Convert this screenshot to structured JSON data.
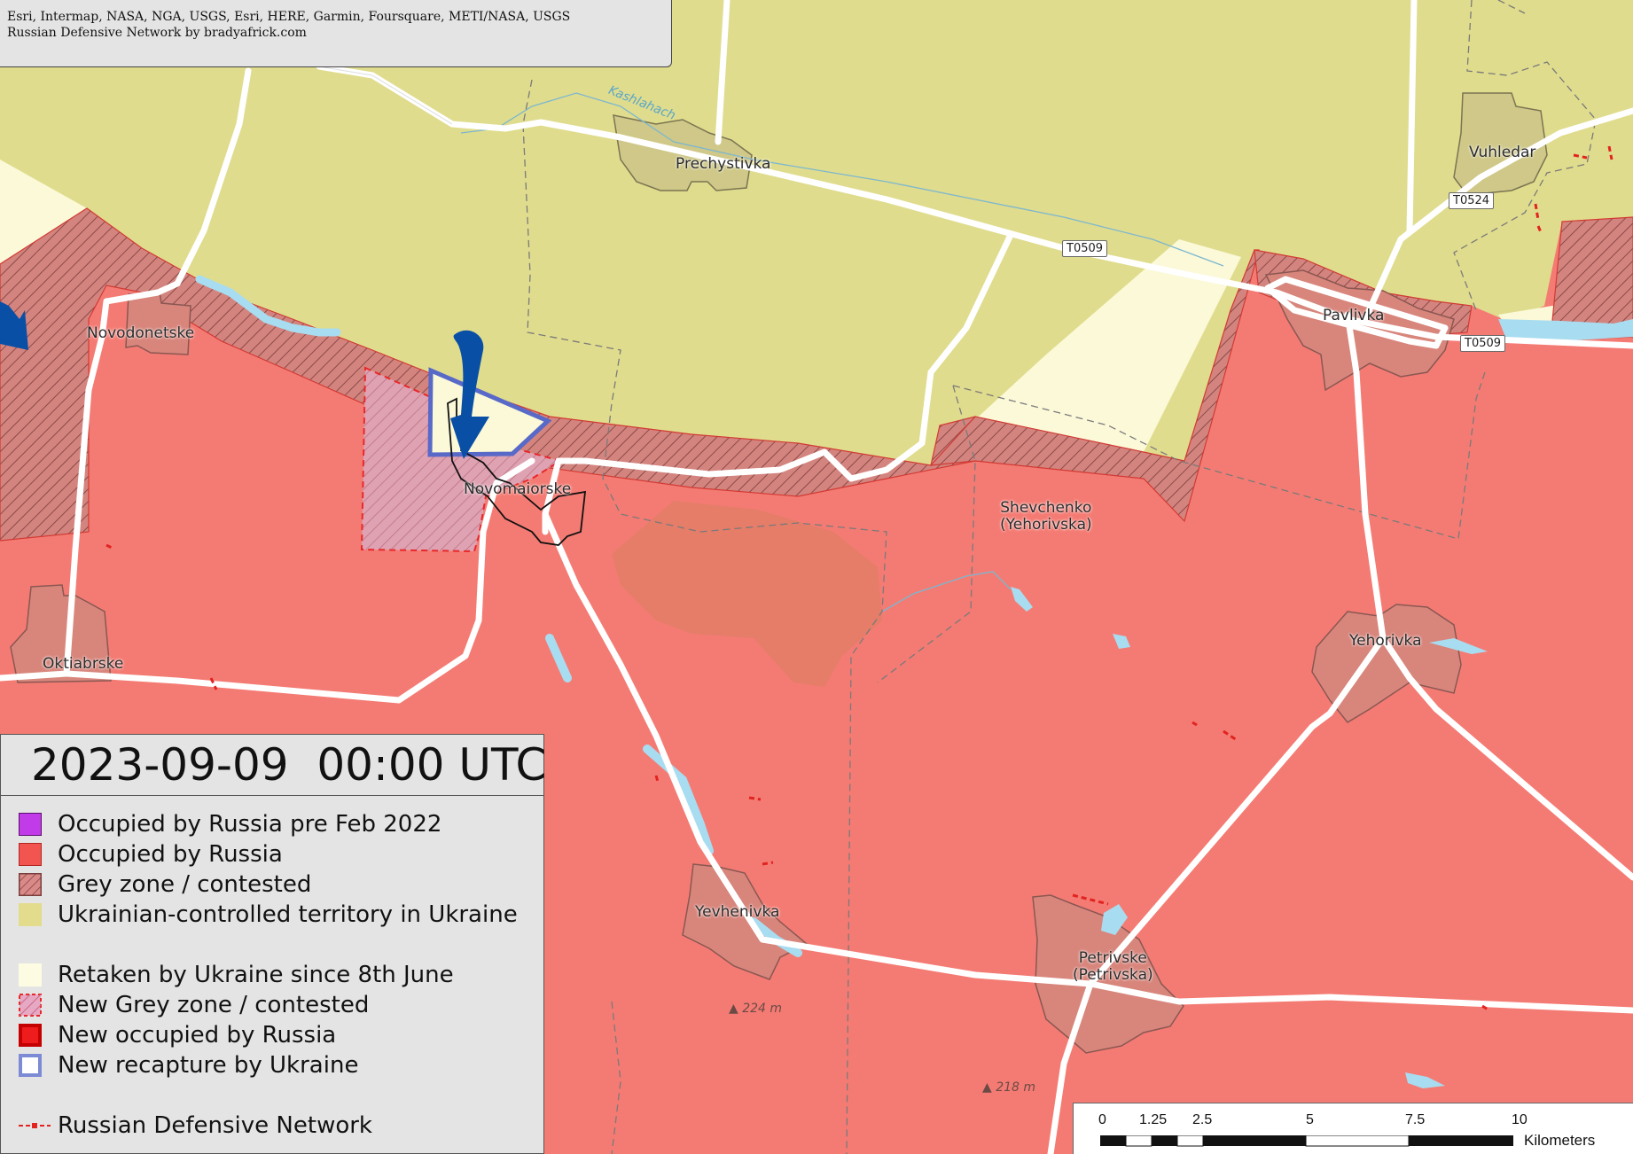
{
  "attribution": {
    "line1": "Esri, Intermap, NASA, NGA, USGS, Esri, HERE, Garmin, Foursquare, METI/NASA, USGS",
    "line2": "Russian Defensive Network by bradyafrick.com"
  },
  "places": {
    "prechystivka": "Prechystivka",
    "vuhledar": "Vuhledar",
    "novodonetske": "Novodonetske",
    "pavlivka": "Pavlivka",
    "novomaiorske": "Novomaiorske",
    "shevchenko_1": "Shevchenko",
    "shevchenko_2": "(Yehorivska)",
    "oktiabrske": "Oktiabrske",
    "yehorivka": "Yehorivka",
    "yevhenivka": "Yevhenivka",
    "petrivske_1": "Petrivske",
    "petrivske_2": "(Petrivska)"
  },
  "roads": {
    "t0509_a": "T0509",
    "t0509_b": "T0509",
    "t0524": "T0524"
  },
  "river": "Kashlahach",
  "elevations": {
    "e1": "224 m",
    "e2": "218 m"
  },
  "legend": {
    "datetime": "2023-09-09  00:00 UTC",
    "items": [
      {
        "label": "Occupied by Russia pre Feb 2022",
        "color": "#c23be8"
      },
      {
        "label": "Occupied by Russia",
        "color": "#f25550"
      },
      {
        "label": "Grey zone / contested",
        "color": "#d9848a"
      },
      {
        "label": "Ukrainian-controlled territory in Ukraine",
        "color": "#e3dc8c"
      },
      {
        "label": "Retaken by Ukraine since 8th June",
        "color": "#fdfce3"
      },
      {
        "label": "New Grey zone / contested",
        "color": "#e7a8c4"
      },
      {
        "label": "New occupied by Russia",
        "color": "#ee1c1c"
      },
      {
        "label": "New recapture by Ukraine",
        "color": "#ffffff"
      },
      {
        "label": "Russian Defensive Network",
        "color": "#e2231f"
      }
    ]
  },
  "colors": {
    "occupied": "#f47b73",
    "ukraine": "#e0dc8d",
    "retaken": "#fbf9d8",
    "settlement_ua": "#cfc888",
    "settlement_ru": "#d8867c",
    "water": "#a8dcf0",
    "arrow": "#0a4fa6"
  },
  "scalebar": {
    "ticks": [
      "0",
      "1.25",
      "2.5",
      "5",
      "7.5",
      "10"
    ],
    "unit": "Kilometers"
  }
}
